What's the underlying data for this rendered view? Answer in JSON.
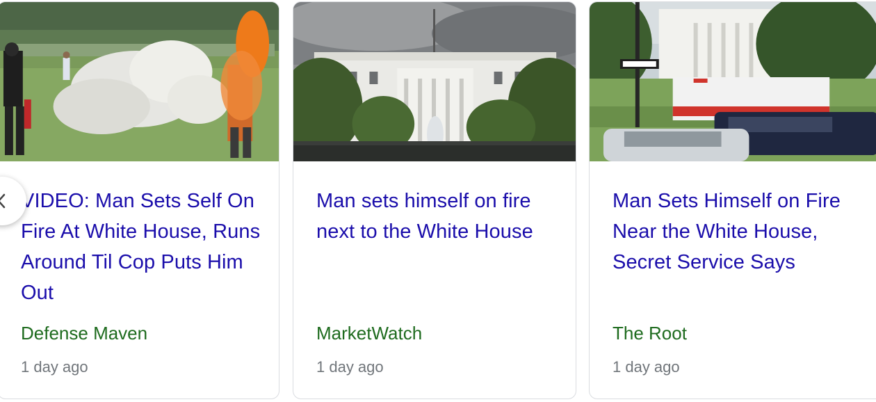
{
  "carousel": {
    "prev_icon": "chevron-left-icon",
    "cards": [
      {
        "image_icon": "photo-man-on-fire-lawn",
        "headline": "VIDEO: Man Sets Self On Fire At White House, Runs Around Til Cop Puts Him Out",
        "source": "Defense Maven",
        "time": "1 day ago"
      },
      {
        "image_icon": "photo-white-house",
        "headline": "Man sets himself on fire next to the White House",
        "source": "MarketWatch",
        "time": "1 day ago"
      },
      {
        "image_icon": "photo-white-house-ambulance",
        "headline": "Man Sets Himself on Fire Near the White House, Secret Service Says",
        "source": "The Root",
        "time": "1 day ago"
      }
    ]
  },
  "colors": {
    "headline": "#1a0dab",
    "source": "#1e6b1e",
    "timestamp": "#70757a",
    "border": "#dadce0"
  }
}
